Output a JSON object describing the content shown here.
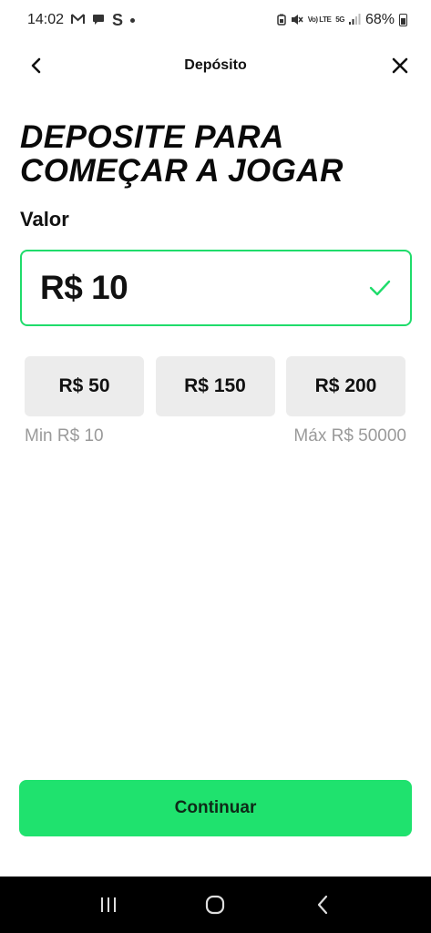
{
  "status_bar": {
    "time": "14:02",
    "left_icons": [
      "gmail-icon",
      "chat-icon",
      "s-app-icon",
      "more-dot-icon"
    ],
    "right_icons": [
      "battery-saver-icon",
      "mute-icon",
      "volte-icon",
      "5g-icon",
      "signal-icon"
    ],
    "volte_text": "Vo) LTE",
    "net_text": "5G",
    "battery": "68%"
  },
  "header": {
    "title": "Depósito",
    "back_icon": "chevron-left-icon",
    "close_icon": "close-icon"
  },
  "headline": {
    "line1": "DEPOSITE PARA",
    "line2": "COMEÇAR A JOGAR"
  },
  "amount": {
    "label": "Valor",
    "value": "R$ 10",
    "valid_icon": "check-icon"
  },
  "quick_amounts": [
    {
      "label": "R$ 50"
    },
    {
      "label": "R$ 150"
    },
    {
      "label": "R$ 200"
    }
  ],
  "limits": {
    "min": "Min R$ 10",
    "max": "Máx R$ 50000"
  },
  "continue_label": "Continuar",
  "nav_bar": {
    "icons": [
      "recent-apps-icon",
      "home-icon",
      "back-icon"
    ]
  },
  "colors": {
    "accent": "#1fe26e",
    "border_accent": "#1fdc6b",
    "chip_bg": "#ececec",
    "muted_text": "#9a9a9a"
  }
}
